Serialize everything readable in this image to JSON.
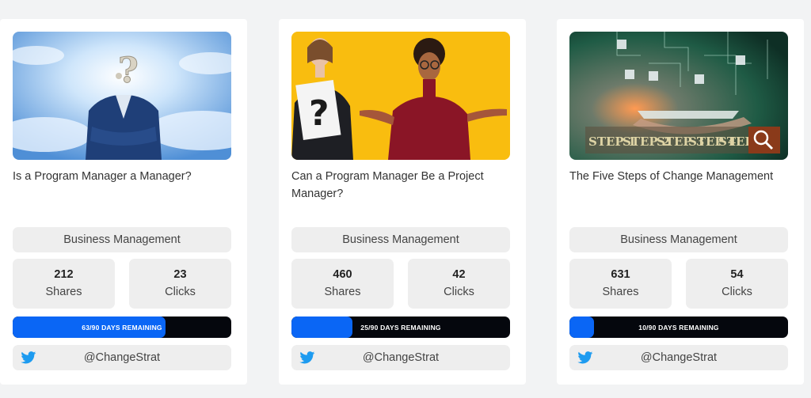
{
  "cards": [
    {
      "image": "program-manager-question-head-photo",
      "title": "Is a Program Manager a Manager?",
      "category": "Business Management",
      "shares": "212",
      "shares_label": "Shares",
      "clicks": "23",
      "clicks_label": "Clicks",
      "days_text": "63/90 DAYS REMAINING",
      "days_progress": 0.7,
      "handle": "@ChangeStrat",
      "handle_icon": "twitter-icon"
    },
    {
      "image": "two-women-question-photo",
      "title": "Can a Program Manager Be a Project Manager?",
      "category": "Business Management",
      "shares": "460",
      "shares_label": "Shares",
      "clicks": "42",
      "clicks_label": "Clicks",
      "days_text": "25/90 DAYS REMAINING",
      "days_progress": 0.2778,
      "handle": "@ChangeStrat",
      "handle_icon": "twitter-icon"
    },
    {
      "image": "five-steps-tablet-photo",
      "title": "The Five Steps of Change Management",
      "category": "Business Management",
      "shares": "631",
      "shares_label": "Shares",
      "clicks": "54",
      "clicks_label": "Clicks",
      "days_text": "10/90 DAYS REMAINING",
      "days_progress": 0.1111,
      "handle": "@ChangeStrat",
      "handle_icon": "twitter-icon",
      "image_steps": [
        "STEP 1",
        "STEP 2",
        "STEP 3",
        "STEP 4",
        "STEP 5"
      ]
    }
  ],
  "colors": {
    "progress_fill": "#0a66f5",
    "progress_track": "#05070d",
    "twitter_blue": "#1d9bf0",
    "tile_bg": "#eeeeee"
  }
}
